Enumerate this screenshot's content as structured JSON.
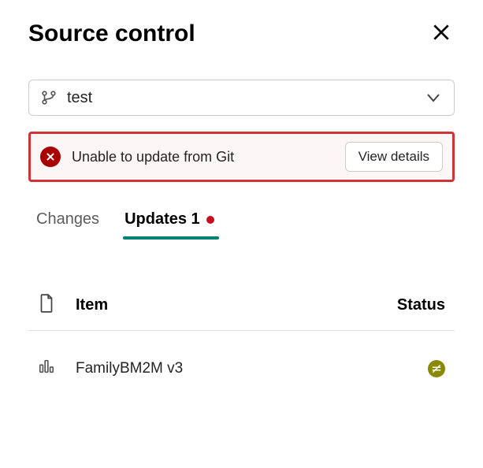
{
  "header": {
    "title": "Source control"
  },
  "branch": {
    "selected": "test"
  },
  "error": {
    "message": "Unable to update from Git",
    "action": "View details"
  },
  "tabs": {
    "changes": {
      "label": "Changes"
    },
    "updates": {
      "label": "Updates 1"
    }
  },
  "table": {
    "headers": {
      "item": "Item",
      "status": "Status"
    },
    "rows": [
      {
        "name": "FamilyBM2M v3"
      }
    ]
  },
  "colors": {
    "error": "#a80000",
    "errorBorder": "#d13438",
    "accent": "#008272",
    "statusBadge": "#8a8a00"
  }
}
